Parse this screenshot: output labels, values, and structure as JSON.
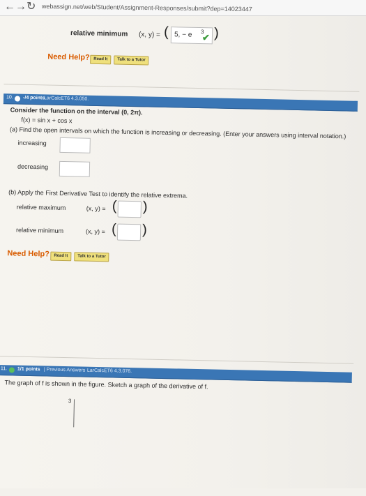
{
  "browser": {
    "url": "webassign.net/web/Student/Assignment-Responses/submit?dep=14023447"
  },
  "prev": {
    "rel_min_label": "relative minimum",
    "xy_label": "(x, y) =",
    "value": "5, − e",
    "value_sup": "3",
    "need_help": "Need Help?",
    "read_it": "Read It",
    "talk_tutor": "Talk to a Tutor"
  },
  "q10": {
    "number": "10.",
    "points": "-/4 points",
    "source": "LarCalcET6 4.3.050.",
    "intro": "Consider the function on the interval (0, 2π).",
    "function": "f(x) = sin x + cos x",
    "part_a": "(a) Find the open intervals on which the function is increasing or decreasing. (Enter your answers using interval notation.)",
    "increasing_label": "increasing",
    "decreasing_label": "decreasing",
    "part_b": "(b) Apply the First Derivative Test to identify the relative extrema.",
    "rel_max_label": "relative maximum",
    "rel_min_label": "relative minimum",
    "xy_label": "(x, y) =",
    "need_help": "Need Help?",
    "read_it": "Read It",
    "talk_tutor": "Talk to a Tutor"
  },
  "q11": {
    "number": "11.",
    "points": "1/1 points",
    "prev_answers": "| Previous Answers",
    "source": "LarCalcET6 4.3.076.",
    "text": "The graph of f is shown in the figure. Sketch a graph of the derivative of f.",
    "graph_label": "3"
  }
}
